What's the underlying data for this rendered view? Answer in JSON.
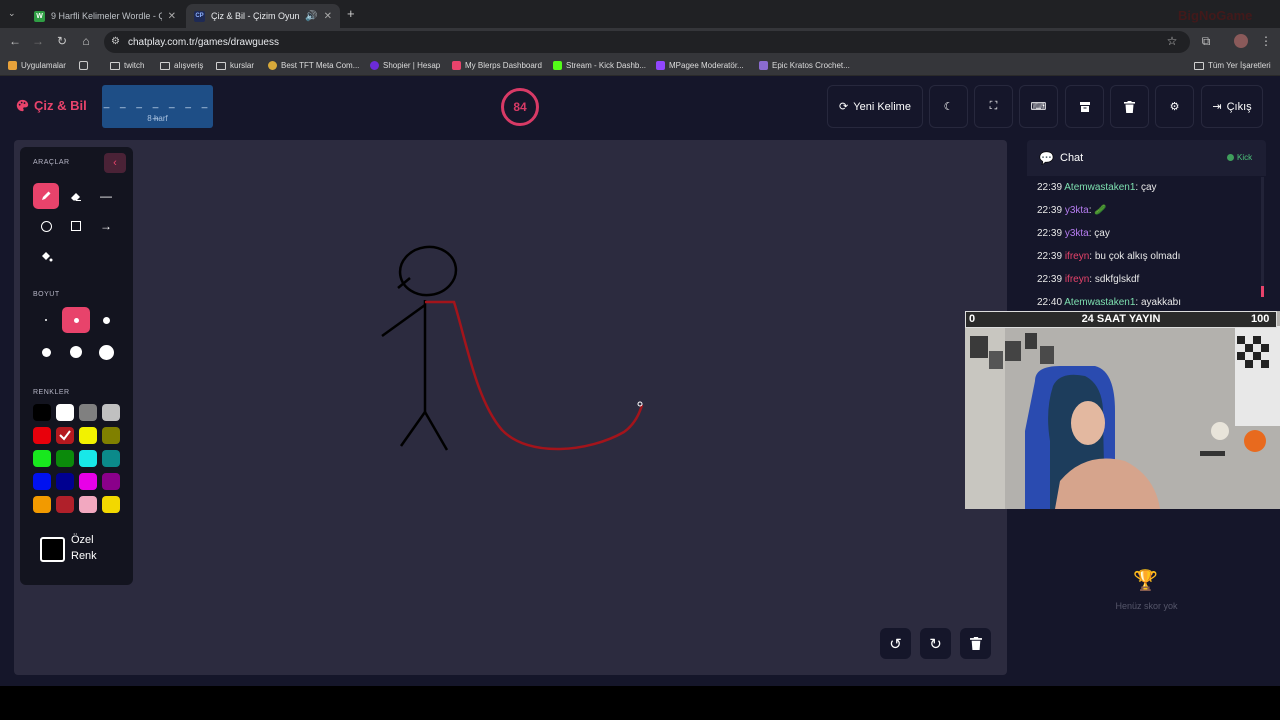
{
  "browser": {
    "tabs": [
      {
        "title": "9 Harfli Kelimeler Wordle - Çev",
        "favicon": "W"
      },
      {
        "title": "Çiz & Bil - Çizim Oyunu",
        "favicon": "CP"
      }
    ],
    "url": "chatplay.com.tr/games/drawguess",
    "bookmarks": [
      "Uygulamalar",
      "twitch",
      "alışveriş",
      "kurslar",
      "Best TFT Meta Com...",
      "Shopier | Hesap",
      "My Blerps Dashboard",
      "Stream - Kick Dashb...",
      "MPagee Moderatör...",
      "Epic Kratos Crochet..."
    ],
    "all_bookmarks": "Tüm Yer İşaretleri"
  },
  "app": {
    "logo": "Çiz & Bil",
    "word_mask": "_ _ _ _ _ _ _ _",
    "word_length": "8 harf",
    "timer": "84",
    "buttons": {
      "new_word": "Yeni Kelime",
      "exit": "Çıkış"
    }
  },
  "tools": {
    "tools_label": "ARAÇLAR",
    "size_label": "BOYUT",
    "colors_label": "RENKLER",
    "custom_color": "Özel Renk",
    "selected_tool": "pen",
    "selected_color": "#b5191f",
    "palette": [
      "#000000",
      "#ffffff",
      "#808080",
      "#c0c0c0",
      "#e8000b",
      "#b5191f",
      "#f2f200",
      "#808000",
      "#18e81e",
      "#0b8a0b",
      "#18e8e8",
      "#0b8a8a",
      "#0011f0",
      "#000090",
      "#e800e8",
      "#8a008a",
      "#f29a00",
      "#b0202a",
      "#f2a8c0",
      "#f2d800"
    ]
  },
  "chat": {
    "title": "Chat",
    "platform": "Kick",
    "messages": [
      {
        "time": "22:39",
        "user": "Atemwastaken1",
        "color": "#7ee0b0",
        "text": ": çay"
      },
      {
        "time": "22:39",
        "user": "y3kta",
        "color": "#b57cf0",
        "text": ":"
      },
      {
        "time": "22:39",
        "user": "y3kta",
        "color": "#b57cf0",
        "text": ": çay"
      },
      {
        "time": "22:39",
        "user": "ifreyn",
        "color": "#e8436b",
        "text": ": bu çok alkış olmadı"
      },
      {
        "time": "22:39",
        "user": "ifreyn",
        "color": "#e8436b",
        "text": ": sdkfglskdf"
      },
      {
        "time": "22:40",
        "user": "Atemwastaken1",
        "color": "#7ee0b0",
        "text": ": ayakkabı"
      }
    ]
  },
  "webcam": {
    "left_value": "0",
    "title": "24 SAAT YAYIN",
    "right_value": "100"
  },
  "scoreboard": {
    "empty_text": "Henüz skor yok"
  }
}
